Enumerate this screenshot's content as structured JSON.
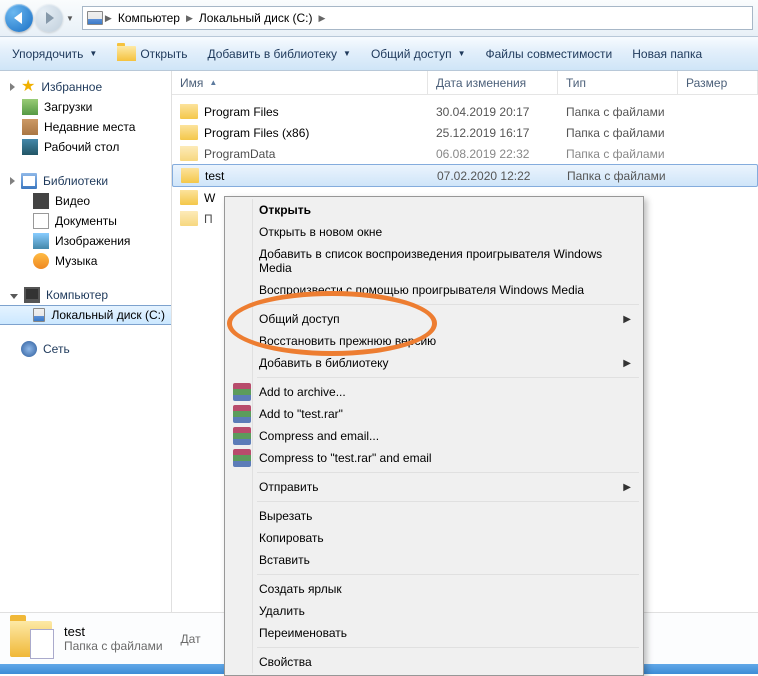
{
  "breadcrumb": {
    "items": [
      "Компьютер",
      "Локальный диск (C:)"
    ]
  },
  "toolbar": {
    "organize": "Упорядочить",
    "open": "Открыть",
    "addToLibrary": "Добавить в библиотеку",
    "share": "Общий доступ",
    "compatFiles": "Файлы совместимости",
    "newFolder": "Новая папка"
  },
  "columns": {
    "name": "Имя",
    "date": "Дата изменения",
    "type": "Тип",
    "size": "Размер"
  },
  "sidebar": {
    "favorites": "Избранное",
    "downloads": "Загрузки",
    "recent": "Недавние места",
    "desktop": "Рабочий стол",
    "libraries": "Библиотеки",
    "video": "Видео",
    "documents": "Документы",
    "pictures": "Изображения",
    "music": "Музыка",
    "computer": "Компьютер",
    "localDisk": "Локальный диск (C:)",
    "network": "Сеть"
  },
  "files": [
    {
      "name": "Program Files",
      "date": "30.04.2019 20:17",
      "type": "Папка с файлами"
    },
    {
      "name": "Program Files (x86)",
      "date": "25.12.2019 16:17",
      "type": "Папка с файлами"
    },
    {
      "name": "ProgramData",
      "date": "06.08.2019 22:32",
      "type": "Папка с файлами"
    },
    {
      "name": "test",
      "date": "07.02.2020 12:22",
      "type": "Папка с файлами"
    },
    {
      "name": "W",
      "date": "",
      "type": ""
    },
    {
      "name": "П",
      "date": "",
      "type": ""
    }
  ],
  "contextMenu": {
    "open": "Открыть",
    "openNew": "Открыть в новом окне",
    "addToPlaylist": "Добавить в список воспроизведения проигрывателя Windows Media",
    "playWith": "Воспроизвести с помощью проигрывателя Windows Media",
    "share": "Общий доступ",
    "restorePrev": "Восстановить прежнюю версию",
    "addToLib": "Добавить в библиотеку",
    "addToArchive": "Add to archive...",
    "addToTestRar": "Add to \"test.rar\"",
    "compressEmail": "Compress and email...",
    "compressTestEmail": "Compress to \"test.rar\" and email",
    "send": "Отправить",
    "cut": "Вырезать",
    "copy": "Копировать",
    "paste": "Вставить",
    "shortcut": "Создать ярлык",
    "delete": "Удалить",
    "rename": "Переименовать",
    "properties": "Свойства"
  },
  "details": {
    "name": "test",
    "type": "Папка с файлами",
    "dateLabel": "Дат"
  }
}
